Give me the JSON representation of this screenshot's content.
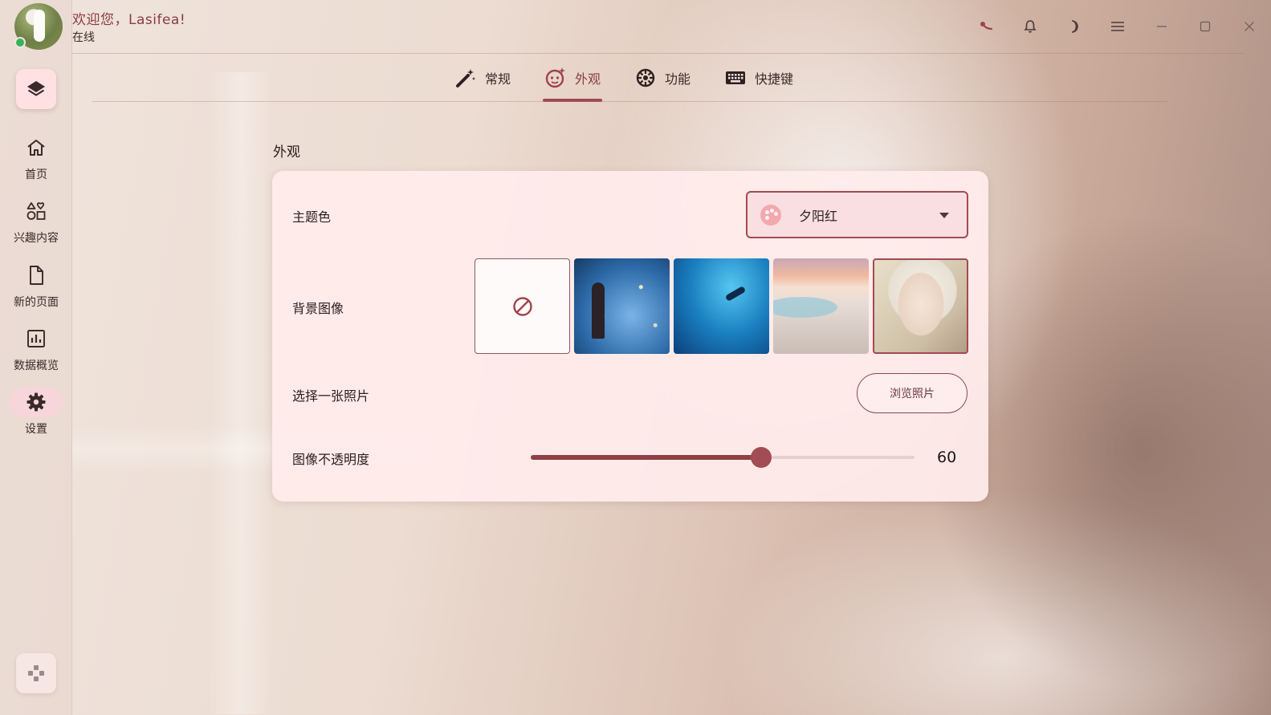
{
  "header": {
    "greeting": "欢迎您，Lasifea!",
    "status": "在线",
    "icons": [
      "signal-icon",
      "bell-icon",
      "moon-icon",
      "menu-icon",
      "minimize-icon",
      "maximize-icon",
      "close-icon"
    ]
  },
  "sidebar": {
    "items": [
      {
        "label": "首页",
        "icon": "home-icon"
      },
      {
        "label": "兴趣内容",
        "icon": "shapes-icon"
      },
      {
        "label": "新的页面",
        "icon": "document-icon"
      },
      {
        "label": "数据概览",
        "icon": "chart-icon"
      },
      {
        "label": "设置",
        "icon": "gear-icon",
        "active": true
      }
    ]
  },
  "tabs": [
    {
      "label": "常规",
      "icon": "magic-wand-icon"
    },
    {
      "label": "外观",
      "icon": "face-sparkle-icon",
      "active": true
    },
    {
      "label": "功能",
      "icon": "wheel-icon"
    },
    {
      "label": "快捷键",
      "icon": "keyboard-icon"
    }
  ],
  "appearance": {
    "section_title": "外观",
    "theme_color": {
      "label": "主题色",
      "value": "夕阳红"
    },
    "background_image": {
      "label": "背景图像",
      "options": [
        "none",
        "violinist-night",
        "underwater-diver",
        "desert-beach",
        "white-hair-girl"
      ],
      "selected_index": 4
    },
    "choose_photo": {
      "label": "选择一张照片",
      "button": "浏览照片"
    },
    "opacity": {
      "label": "图像不透明度",
      "value": 60,
      "min": 0,
      "max": 100,
      "display": "60"
    }
  },
  "colors": {
    "accent": "#a44a52",
    "accent_dark": "#8e4046",
    "card_bg": "#ffecec",
    "greeting": "#8a3c40",
    "online": "#35b35a"
  }
}
